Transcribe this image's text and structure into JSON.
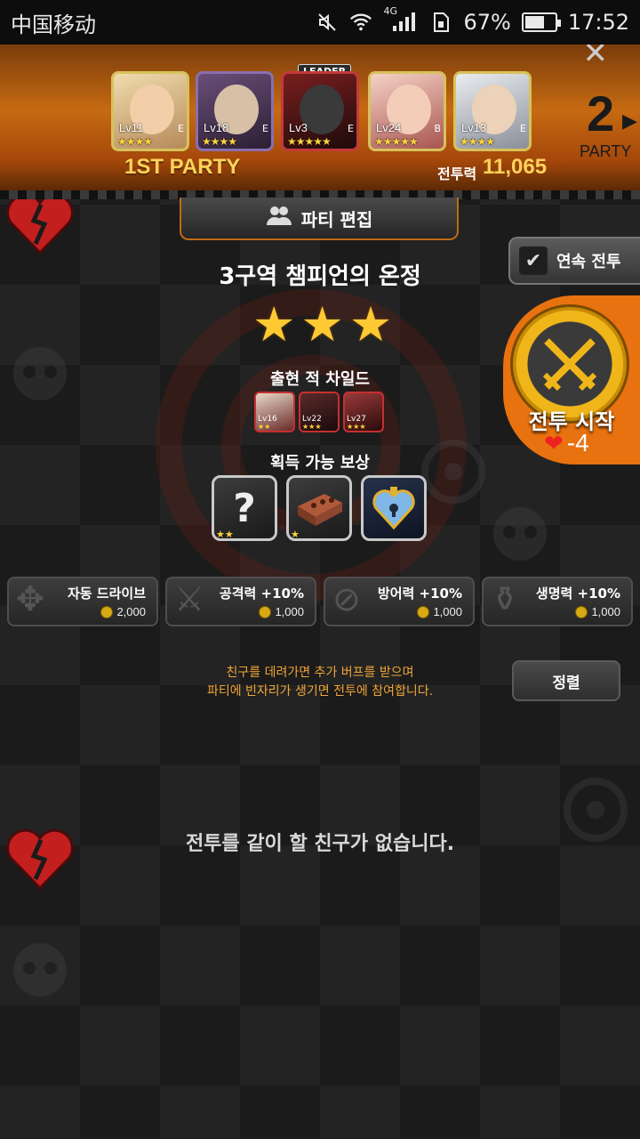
{
  "status_bar": {
    "carrier": "中国移动",
    "network": "4G",
    "battery": "67%",
    "battery_level": 0.67,
    "time": "17:52"
  },
  "party": {
    "label": "1ST PARTY",
    "leader_tag": "LEADER",
    "power_label": "전투력",
    "power_value": "11,065",
    "next_party_number": "2",
    "next_party_label": "PARTY",
    "members": [
      {
        "level": "Lv11",
        "stars": 4,
        "element": "E"
      },
      {
        "level": "Lv18",
        "stars": 4,
        "element": "E"
      },
      {
        "level": "Lv3",
        "stars": 5,
        "element": "E"
      },
      {
        "level": "Lv24",
        "stars": 5,
        "element": "B"
      },
      {
        "level": "Lv13",
        "stars": 4,
        "element": "E"
      }
    ]
  },
  "edit_button": "파티 편집",
  "auto_battle": {
    "label": "연속 전투",
    "checked": true
  },
  "stage": {
    "title": "3구역 챔피언의 온정",
    "stars": 3,
    "enemies_label": "출현 적 차일드",
    "enemies": [
      {
        "level": "Lv16",
        "stars": 2
      },
      {
        "level": "Lv22",
        "stars": 3
      },
      {
        "level": "Lv27",
        "stars": 3
      }
    ],
    "rewards_label": "획득 가능 보상",
    "rewards": [
      {
        "icon": "question-mark",
        "stars": 2
      },
      {
        "icon": "brick",
        "stars": 1
      },
      {
        "icon": "heart-lock",
        "stars": 0
      }
    ]
  },
  "battle_start": {
    "label": "전투 시작",
    "cost": "-4"
  },
  "buffs": [
    {
      "name": "자동 드라이브",
      "cost": "2,000",
      "icon": "wing-emblem"
    },
    {
      "name": "공격력 +10%",
      "cost": "1,000",
      "icon": "crossed-swords"
    },
    {
      "name": "방어력 +10%",
      "cost": "1,000",
      "icon": "shield"
    },
    {
      "name": "생명력 +10%",
      "cost": "1,000",
      "icon": "potion"
    }
  ],
  "friend_hint": {
    "line1": "친구를 데려가면 추가 버프를 받으며",
    "line2": "파티에 빈자리가 생기면 전투에 참여합니다."
  },
  "sort_button": "정렬",
  "empty_message": "전투를 같이 할 친구가 없습니다."
}
